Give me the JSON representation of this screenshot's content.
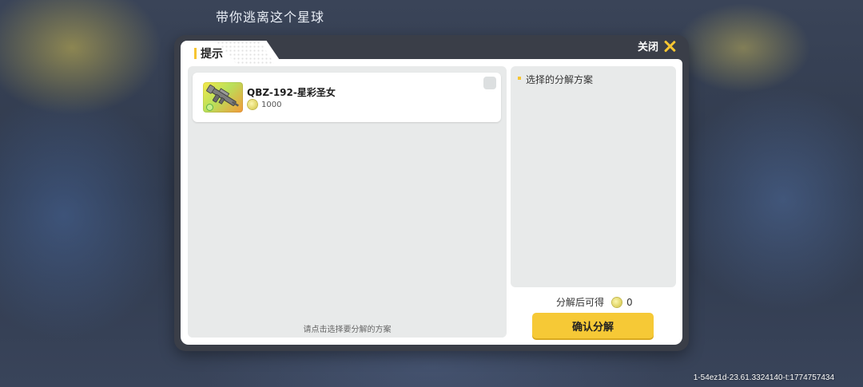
{
  "background": {
    "title": "带你逃离这个星球",
    "watermark": "1-54ez1d-23.61.3324140-t:1774757434"
  },
  "dialog": {
    "tab_label": "提示",
    "close_label": "关闭",
    "items": [
      {
        "name": "QBZ-192-星彩圣女",
        "price": "1000",
        "icon": "rifle-icon",
        "selected": false
      }
    ],
    "hint": "请点击选择要分解的方案",
    "scheme_label": "选择的分解方案",
    "yield_label": "分解后可得",
    "yield_value": "0",
    "confirm_label": "确认分解"
  },
  "colors": {
    "accent": "#f6c532",
    "panel": "#e8eaea"
  }
}
